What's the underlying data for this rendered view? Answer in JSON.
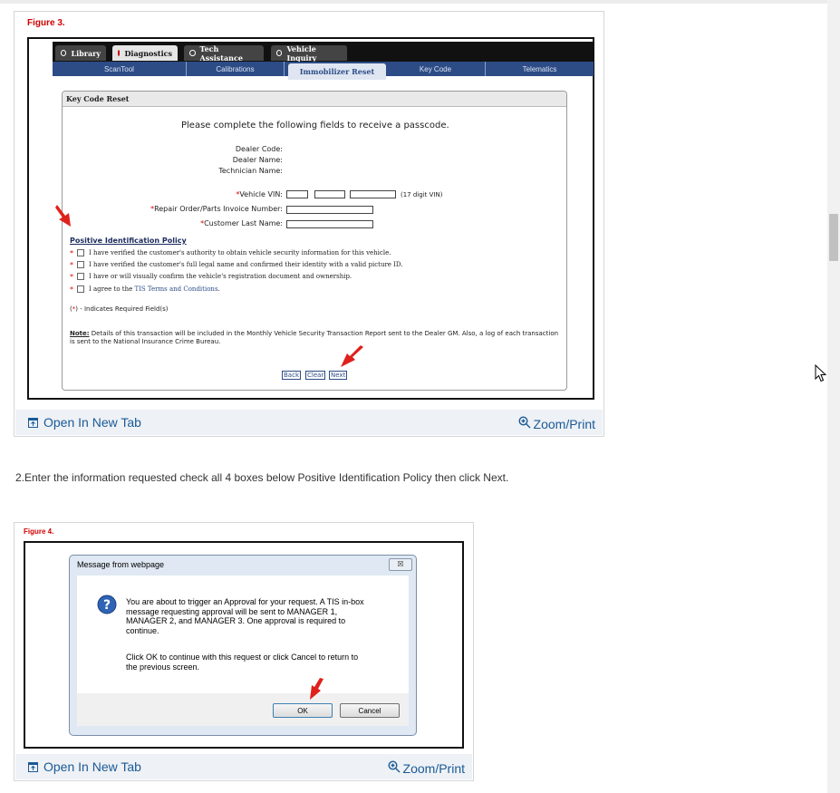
{
  "figure3": {
    "label": "Figure 3.",
    "top_tabs": [
      {
        "label": "Library",
        "active": false
      },
      {
        "label": "Diagnostics",
        "active": true
      },
      {
        "label": "Tech Assistance",
        "active": false
      },
      {
        "label": "Vehicle Inquiry",
        "active": false
      }
    ],
    "sub_tabs": [
      {
        "label": "ScanTool",
        "active": false
      },
      {
        "label": "Calibrations",
        "active": false
      },
      {
        "label": "Immobilizer Reset",
        "active": true
      },
      {
        "label": "Key Code",
        "active": false
      },
      {
        "label": "Telematics",
        "active": false
      }
    ],
    "panel_title": "Key Code Reset",
    "intro": "Please complete the following fields to receive a passcode.",
    "dealer_code_label": "Dealer Code:",
    "dealer_name_label": "Dealer Name:",
    "technician_name_label": "Technician Name:",
    "vin_label": "Vehicle VIN:",
    "vin_hint": "(17 digit VIN)",
    "repair_order_label": "Repair Order/Parts Invoice Number:",
    "customer_last_name_label": "Customer Last Name:",
    "required_mark": "*",
    "policy_title": "Positive Identification Policy",
    "policy_items": [
      "I have verified the customer's authority to obtain vehicle security information for this vehicle.",
      "I have verified the customer's full legal name and confirmed their identity with a valid picture ID.",
      "I have or will visually confirm the vehicle's registration document and ownership."
    ],
    "terms_prefix": "I agree to the",
    "terms_link": "TIS Terms and Conditions",
    "terms_suffix": ".",
    "required_note_open": "(",
    "required_note_close": ") - Indicates Required Field(s)",
    "note_label": "Note:",
    "note_text": "Details of this transaction will be included in the Monthly Vehicle Security Transaction Report sent to the Dealer GM. Also, a log of each transaction is sent to the National Insurance Crime Bureau.",
    "buttons": {
      "back": "Back",
      "clear": "Clear",
      "next": "Next"
    },
    "open_new_tab": "Open In New Tab",
    "zoom_print": "Zoom/Print"
  },
  "instruction": "2.Enter the information requested check all 4 boxes below Positive Identification Policy then click Next.",
  "figure4": {
    "label": "Figure 4.",
    "dialog_title": "Message from webpage",
    "close_glyph": "☒",
    "message_p1_lines": [
      "You are about to trigger an Approval for your request. A TIS in-box",
      "message requesting approval will be sent to MANAGER 1,",
      "MANAGER 2, and MANAGER 3. One approval is required to",
      "continue."
    ],
    "message_p2_lines": [
      "Click OK to continue with this request or click Cancel to return to",
      "the previous screen."
    ],
    "ok_label": "OK",
    "cancel_label": "Cancel",
    "open_new_tab": "Open In New Tab",
    "zoom_print": "Zoom/Print"
  },
  "colors": {
    "figure_label": "#d00000",
    "link": "#1a5a96",
    "nav_blue": "#2d4c86",
    "arrow_red": "#e0201b"
  }
}
